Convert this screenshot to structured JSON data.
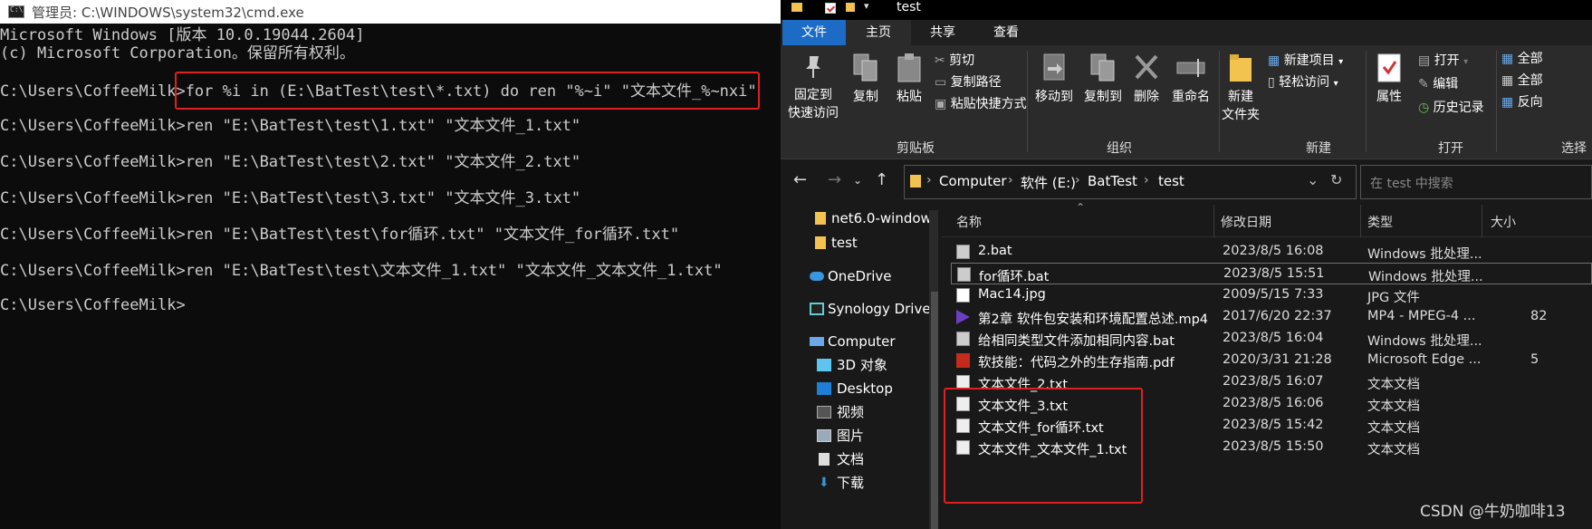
{
  "cmd": {
    "title": "管理员: C:\\WINDOWS\\system32\\cmd.exe",
    "lines": [
      "Microsoft Windows [版本 10.0.19044.2604]",
      "(c) Microsoft Corporation。保留所有权利。",
      "",
      "C:\\Users\\CoffeeMilk>for %i in (E:\\BatTest\\test\\*.txt) do ren \"%~i\" \"文本文件_%~nxi\"",
      "",
      "C:\\Users\\CoffeeMilk>ren \"E:\\BatTest\\test\\1.txt\" \"文本文件_1.txt\"",
      "",
      "C:\\Users\\CoffeeMilk>ren \"E:\\BatTest\\test\\2.txt\" \"文本文件_2.txt\"",
      "",
      "C:\\Users\\CoffeeMilk>ren \"E:\\BatTest\\test\\3.txt\" \"文本文件_3.txt\"",
      "",
      "C:\\Users\\CoffeeMilk>ren \"E:\\BatTest\\test\\for循环.txt\" \"文本文件_for循环.txt\"",
      "",
      "C:\\Users\\CoffeeMilk>ren \"E:\\BatTest\\test\\文本文件_1.txt\" \"文本文件_文本文件_1.txt\"",
      "",
      "C:\\Users\\CoffeeMilk>"
    ]
  },
  "explorer": {
    "title": "test",
    "tabs": {
      "file": "文件",
      "home": "主页",
      "share": "共享",
      "view": "查看"
    },
    "ribbon": {
      "pin": [
        "固定到",
        "快速访问"
      ],
      "copy": "复制",
      "paste": "粘贴",
      "cut": "剪切",
      "copy_path": "复制路径",
      "paste_shortcut": "粘贴快捷方式",
      "clipboard_group": "剪贴板",
      "move_to": "移动到",
      "copy_to": "复制到",
      "delete": "删除",
      "rename": "重命名",
      "organize_group": "组织",
      "new_folder": [
        "新建",
        "文件夹"
      ],
      "new_item": "新建项目",
      "easy_access": "轻松访问",
      "new_group": "新建",
      "properties": "属性",
      "open": "打开",
      "edit": "编辑",
      "history": "历史记录",
      "open_group": "打开",
      "select_all": "全部",
      "select_none": "全部",
      "invert": "反向",
      "select_group": "选择"
    },
    "address": {
      "crumbs": [
        "Computer",
        "软件 (E:)",
        "BatTest",
        "test"
      ]
    },
    "search_placeholder": "在 test 中搜索",
    "nav": [
      "net6.0-window",
      "test",
      "OneDrive",
      "Synology Drive",
      "Computer",
      "3D 对象",
      "Desktop",
      "视频",
      "图片",
      "文档",
      "下载"
    ],
    "columns": [
      "名称",
      "修改日期",
      "类型",
      "大小"
    ],
    "files": [
      {
        "name": "2.bat",
        "date": "2023/8/5 16:08",
        "type": "Windows 批处理...",
        "size": ""
      },
      {
        "name": "for循环.bat",
        "date": "2023/8/5 15:51",
        "type": "Windows 批处理...",
        "size": ""
      },
      {
        "name": "Mac14.jpg",
        "date": "2009/5/15 7:33",
        "type": "JPG 文件",
        "size": ""
      },
      {
        "name": "第2章 软件包安装和环境配置总述.mp4",
        "date": "2017/6/20 22:37",
        "type": "MP4 - MPEG-4 ...",
        "size": "82"
      },
      {
        "name": "给相同类型文件添加相同内容.bat",
        "date": "2023/8/5 16:04",
        "type": "Windows 批处理...",
        "size": ""
      },
      {
        "name": "软技能：代码之外的生存指南.pdf",
        "date": "2020/3/31 21:28",
        "type": "Microsoft Edge ...",
        "size": "5"
      },
      {
        "name": "文本文件_2.txt",
        "date": "2023/8/5 16:07",
        "type": "文本文档",
        "size": ""
      },
      {
        "name": "文本文件_3.txt",
        "date": "2023/8/5 16:06",
        "type": "文本文档",
        "size": ""
      },
      {
        "name": "文本文件_for循环.txt",
        "date": "2023/8/5 15:42",
        "type": "文本文档",
        "size": ""
      },
      {
        "name": "文本文件_文本文件_1.txt",
        "date": "2023/8/5 15:50",
        "type": "文本文档",
        "size": ""
      }
    ]
  },
  "watermark": "CSDN @牛奶咖啡13"
}
